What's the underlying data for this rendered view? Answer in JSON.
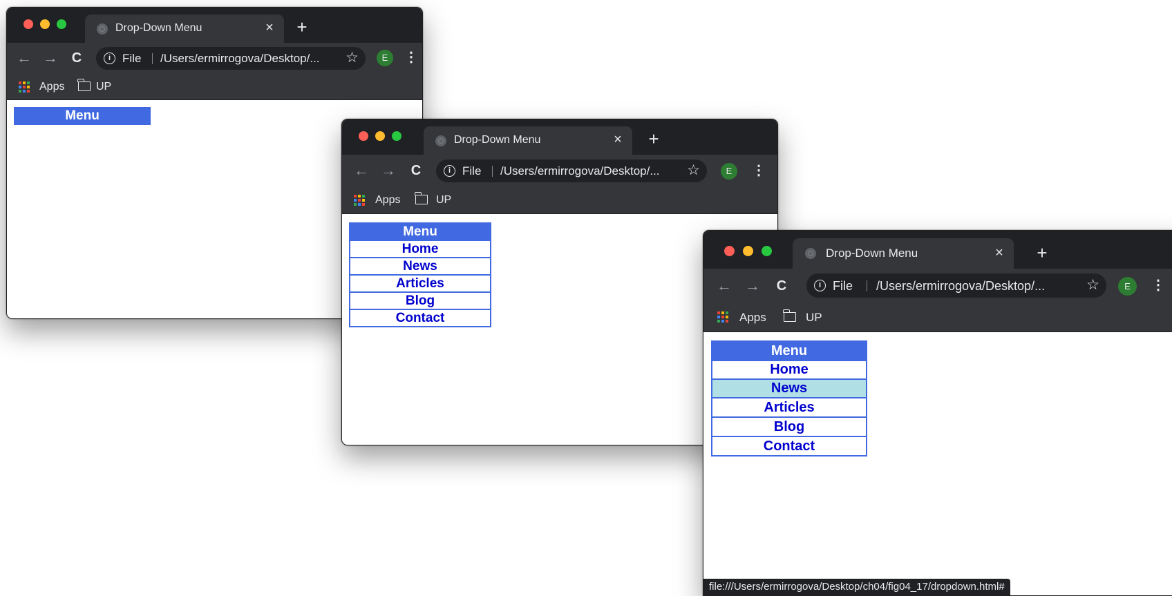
{
  "windows": [
    {
      "tab": {
        "title": "Drop-Down Menu"
      },
      "address": {
        "scheme": "File",
        "url": "/Users/ermirrogova/Desktop/..."
      },
      "profile_initial": "E",
      "bookmarks": [
        {
          "label": "Apps"
        },
        {
          "label": "UP"
        }
      ],
      "menu": {
        "header": "Menu",
        "items": []
      }
    },
    {
      "tab": {
        "title": "Drop-Down Menu"
      },
      "address": {
        "scheme": "File",
        "url": "/Users/ermirrogova/Desktop/..."
      },
      "profile_initial": "E",
      "bookmarks": [
        {
          "label": "Apps"
        },
        {
          "label": "UP"
        }
      ],
      "menu": {
        "header": "Menu",
        "items": [
          "Home",
          "News",
          "Articles",
          "Blog",
          "Contact"
        ]
      }
    },
    {
      "tab": {
        "title": "Drop-Down Menu"
      },
      "address": {
        "scheme": "File",
        "url": "/Users/ermirrogova/Desktop/..."
      },
      "profile_initial": "E",
      "bookmarks": [
        {
          "label": "Apps"
        },
        {
          "label": "UP"
        }
      ],
      "menu": {
        "header": "Menu",
        "items": [
          "Home",
          "News",
          "Articles",
          "Blog",
          "Contact"
        ],
        "hovered_item": "News"
      },
      "status_url": "file:///Users/ermirrogova/Desktop/ch04/fig04_17/dropdown.html#"
    }
  ],
  "icons": {
    "close": "×",
    "new_tab": "+",
    "back": "←",
    "forward": "→",
    "reload": "C",
    "info": "i",
    "star": "☆",
    "menu": "⋮"
  },
  "colors": {
    "menu_header_bg": "#4169e1",
    "menu_item_text": "#0000cd",
    "menu_hover_bg": "#b0e0e6",
    "chrome_dark": "#202124",
    "chrome_toolbar": "#35363a",
    "apps_grid": [
      "#ea4335",
      "#fbbc04",
      "#34a853",
      "#4285f4",
      "#ea4335",
      "#fbbc04",
      "#34a853",
      "#4285f4",
      "#ea4335"
    ]
  }
}
